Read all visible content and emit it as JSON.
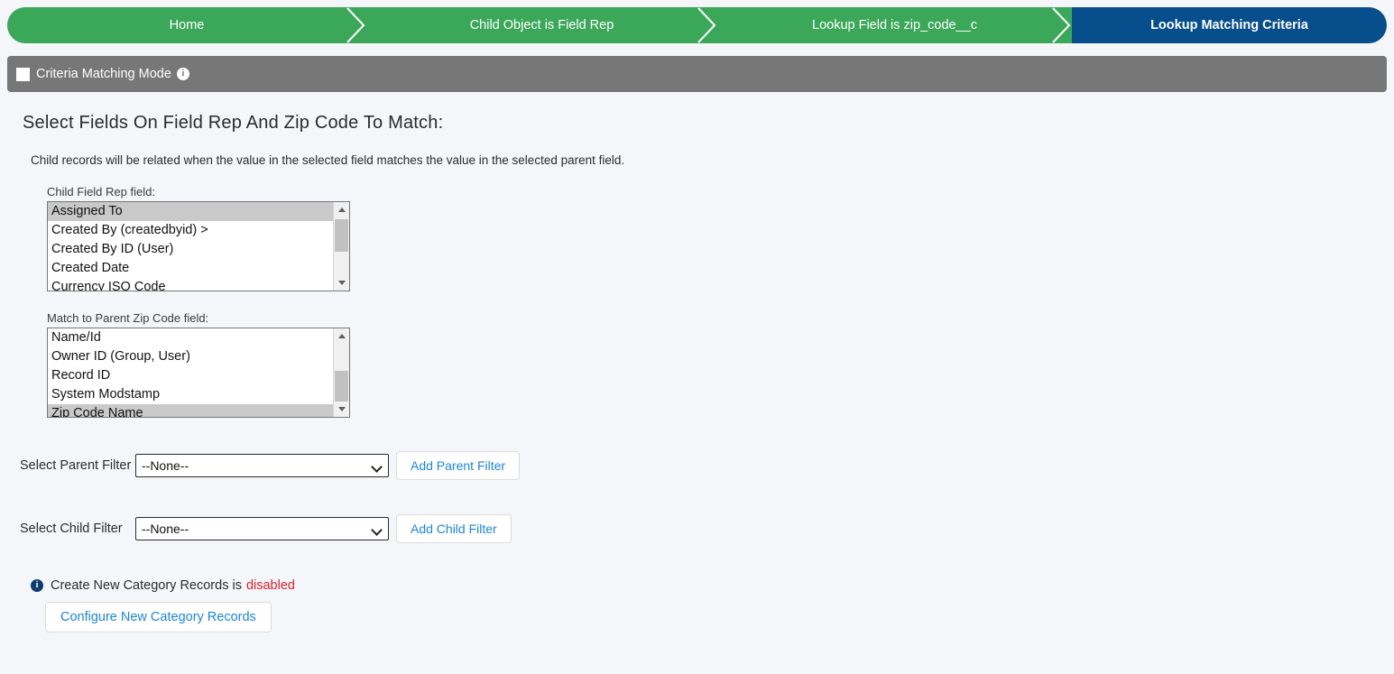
{
  "breadcrumb": {
    "steps": [
      {
        "label": "Home",
        "state": "complete"
      },
      {
        "label": "Child Object is Field Rep",
        "state": "complete"
      },
      {
        "label": "Lookup Field is zip_code__c",
        "state": "complete"
      },
      {
        "label": "Lookup Matching Criteria",
        "state": "current"
      }
    ],
    "colors": {
      "complete": "#3ba758",
      "current": "#074e8c"
    }
  },
  "mode_bar": {
    "checkbox_label": "Criteria Matching Mode",
    "checkbox_checked": true,
    "info_icon": "info-icon",
    "background": "#777777"
  },
  "main": {
    "title": "Select Fields On Field Rep And Zip Code To Match:",
    "description": "Child records will be related when the value in the selected field matches the value in the selected parent field.",
    "child_field": {
      "label": "Child Field Rep field:",
      "options": [
        "Assigned To",
        "Created By (createdbyid) >",
        "Created By ID (User)",
        "Created Date",
        "Currency ISO Code"
      ],
      "selected": "Assigned To",
      "scroll_position": "top"
    },
    "parent_field": {
      "label": "Match to Parent Zip Code field:",
      "options": [
        "Name/Id",
        "Owner ID (Group, User)",
        "Record ID",
        "System Modstamp",
        "Zip Code Name"
      ],
      "selected": "Zip Code Name",
      "scroll_position": "bottom"
    },
    "parent_filter": {
      "label": "Select Parent Filter",
      "value": "--None--",
      "button": "Add Parent Filter"
    },
    "child_filter": {
      "label": "Select Child Filter",
      "value": "--None--",
      "button": "Add Child Filter"
    },
    "category": {
      "info_icon": "info-icon",
      "text": "Create New Category Records is",
      "status": "disabled",
      "status_color": "#e0202a",
      "button": "Configure New Category Records"
    }
  }
}
